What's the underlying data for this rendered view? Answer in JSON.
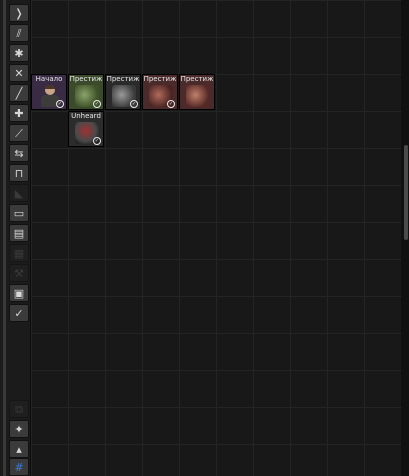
{
  "sidebar": {
    "tools": [
      {
        "icon": "brush-icon"
      },
      {
        "icon": "multi-brush-icon"
      },
      {
        "icon": "gear-icon"
      },
      {
        "icon": "close-icon"
      },
      {
        "icon": "line-icon"
      },
      {
        "icon": "add-icon"
      },
      {
        "icon": "knife-icon"
      },
      {
        "icon": "swap-icon"
      },
      {
        "icon": "measure-icon"
      },
      {
        "icon": "shoe-icon"
      },
      {
        "icon": "toolbox-icon"
      },
      {
        "icon": "clipboard-icon"
      },
      {
        "icon": "stack-icon"
      },
      {
        "icon": "wrench-icon"
      },
      {
        "icon": "document-icon"
      },
      {
        "icon": "checkmark-icon"
      }
    ],
    "bottom_tools": [
      {
        "icon": "copy-icon"
      },
      {
        "icon": "pin-icon"
      },
      {
        "icon": "lock-icon"
      },
      {
        "icon": "tag-icon"
      }
    ]
  },
  "tree": {
    "nodes": [
      {
        "label": "Начало",
        "completed": true,
        "art": "soldier-portrait",
        "color": "#3a2b45"
      },
      {
        "label": "Престиж",
        "completed": true,
        "art": "green-prestige-ammo",
        "color": "#3a4a2a"
      },
      {
        "label": "Престиж",
        "completed": true,
        "art": "gray-prestige-ammo",
        "color": "#2a2a2a"
      },
      {
        "label": "Престиж",
        "completed": true,
        "art": "red-prestige-ammo",
        "color": "#4a2a2a"
      },
      {
        "label": "Престиж",
        "completed": false,
        "art": "red-prestige-ammo",
        "color": "#4a2a2a"
      },
      {
        "label": "Unheard",
        "completed": true,
        "art": "unheard-pack",
        "color": "#2c2c2c"
      }
    ]
  }
}
